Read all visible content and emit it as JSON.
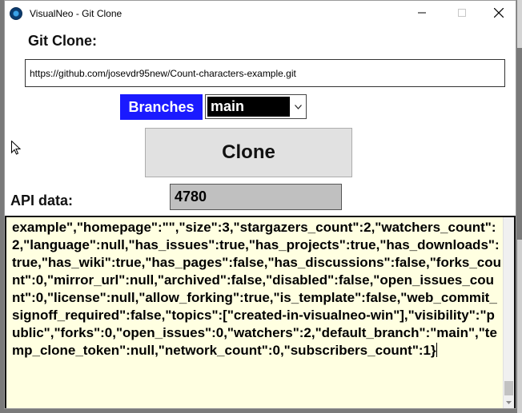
{
  "window": {
    "title": "VisualNeo - Git Clone"
  },
  "form": {
    "heading": "Git Clone:",
    "repo_url": "https://github.com/josevdr95new/Count-characters-example.git",
    "branches_label": "Branches",
    "branch_selected": "main",
    "clone_label": "Clone",
    "api_label": "API data:",
    "char_count": "4780",
    "api_text": "example\",\"homepage\":\"\",\"size\":3,\"stargazers_count\":2,\"watchers_count\":2,\"language\":null,\"has_issues\":true,\"has_projects\":true,\"has_downloads\":true,\"has_wiki\":true,\"has_pages\":false,\"has_discussions\":false,\"forks_count\":0,\"mirror_url\":null,\"archived\":false,\"disabled\":false,\"open_issues_count\":0,\"license\":null,\"allow_forking\":true,\"is_template\":false,\"web_commit_signoff_required\":false,\"topics\":[\"created-in-visualneo-win\"],\"visibility\":\"public\",\"forks\":0,\"open_issues\":0,\"watchers\":2,\"default_branch\":\"main\",\"temp_clone_token\":null,\"network_count\":0,\"subscribers_count\":1}"
  },
  "icons": {
    "app": "visualneo-logo-icon",
    "minimize": "minimize-icon",
    "maximize": "maximize-icon",
    "close": "close-icon",
    "dropdown": "chevron-down-icon",
    "cursor": "mouse-pointer-icon"
  },
  "colors": {
    "branches_bg": "#1a1aff",
    "select_bg": "#000000",
    "count_bg": "#c0c0c0",
    "textarea_bg": "#ffffe1",
    "button_bg": "#e1e1e1"
  }
}
